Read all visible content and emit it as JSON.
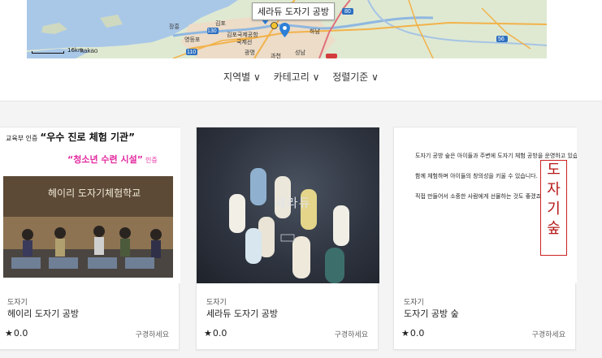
{
  "map": {
    "tooltip": "세라듀 도자기 공방",
    "scale_text": "16km",
    "brand": "kakao",
    "place_labels": [
      "김포",
      "김포국제공항",
      "국제선",
      "영등포",
      "하남",
      "성남",
      "과천",
      "장흥",
      "광명"
    ],
    "road_labels": [
      "130",
      "80",
      "110",
      "56"
    ]
  },
  "filters": [
    {
      "label": "지역별 ∨"
    },
    {
      "label": "카테고리 ∨"
    },
    {
      "label": "정렬기준 ∨"
    }
  ],
  "cards": [
    {
      "category": "도자기",
      "title": "헤이리 도자기 공방",
      "rating_star": "★",
      "rating": "0.0",
      "browse_label": "구경하세요",
      "image": {
        "ministry_prefix": "교육부 인증",
        "ministry_title": "“우수 진로 체험 기관”",
        "youth_title": "“청소년 수련 시설”",
        "youth_suffix": "인증",
        "photo_caption": "헤이리 도자기체험학교"
      }
    },
    {
      "category": "도자기",
      "title": "세라듀 도자기 공방",
      "rating_star": "★",
      "rating": "0.0",
      "browse_label": "구경하세요",
      "image": {
        "brand": "세라듀"
      }
    },
    {
      "category": "도자기",
      "title": "도자기 공방 숲",
      "rating_star": "★",
      "rating": "0.0",
      "browse_label": "구경하세요",
      "image": {
        "lines": [
          "도자기 공방 숲은 아이들과 주변에 도자기 체험 공방을 운영하고 있습니다",
          "함께 체험하며 아이들의 창의성을 키울 수 있습니다.",
          "직접 만들어서 소중한 사람에게 선물하는 것도 좋겠죠?"
        ],
        "logo_text": "도자기 숲"
      }
    }
  ],
  "colors": {
    "map_land": "#dfe9d2",
    "map_water": "#a9c8e8",
    "map_pin": "#2e7fd6",
    "highlight_pink": "#e32aa0",
    "logo_red": "#b51818"
  }
}
